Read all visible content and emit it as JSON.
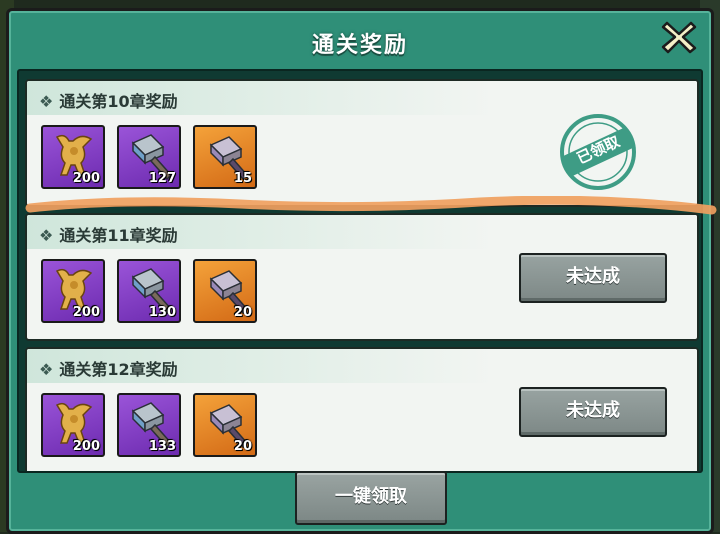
{
  "dialog": {
    "title": "通关奖励",
    "close_icon": "close-x-icon"
  },
  "rewards": [
    {
      "title": "通关第10章奖励",
      "status": "claimed",
      "stamp_text": "已领取",
      "items": [
        {
          "icon": "golden-vessel-icon",
          "rarity": "purple",
          "count": "200"
        },
        {
          "icon": "hammer-icon",
          "rarity": "purple",
          "count": "127"
        },
        {
          "icon": "hammer-icon",
          "rarity": "orange",
          "count": "15"
        }
      ]
    },
    {
      "title": "通关第11章奖励",
      "status": "locked",
      "button_label": "未达成",
      "items": [
        {
          "icon": "golden-vessel-icon",
          "rarity": "purple",
          "count": "200"
        },
        {
          "icon": "hammer-icon",
          "rarity": "purple",
          "count": "130"
        },
        {
          "icon": "hammer-icon",
          "rarity": "orange",
          "count": "20"
        }
      ]
    },
    {
      "title": "通关第12章奖励",
      "status": "locked",
      "button_label": "未达成",
      "items": [
        {
          "icon": "golden-vessel-icon",
          "rarity": "purple",
          "count": "200"
        },
        {
          "icon": "hammer-icon",
          "rarity": "purple",
          "count": "133"
        },
        {
          "icon": "hammer-icon",
          "rarity": "orange",
          "count": "20"
        }
      ]
    }
  ],
  "footer": {
    "claim_all_label": "一键领取"
  },
  "colors": {
    "dialog_green": "#2f8f78",
    "card_bg": "#f2f5f2",
    "purple_rarity": "#7a35c0",
    "orange_rarity": "#e07a1f",
    "button_grey": "#8a9492",
    "annotation_stroke": "#f0a060"
  }
}
